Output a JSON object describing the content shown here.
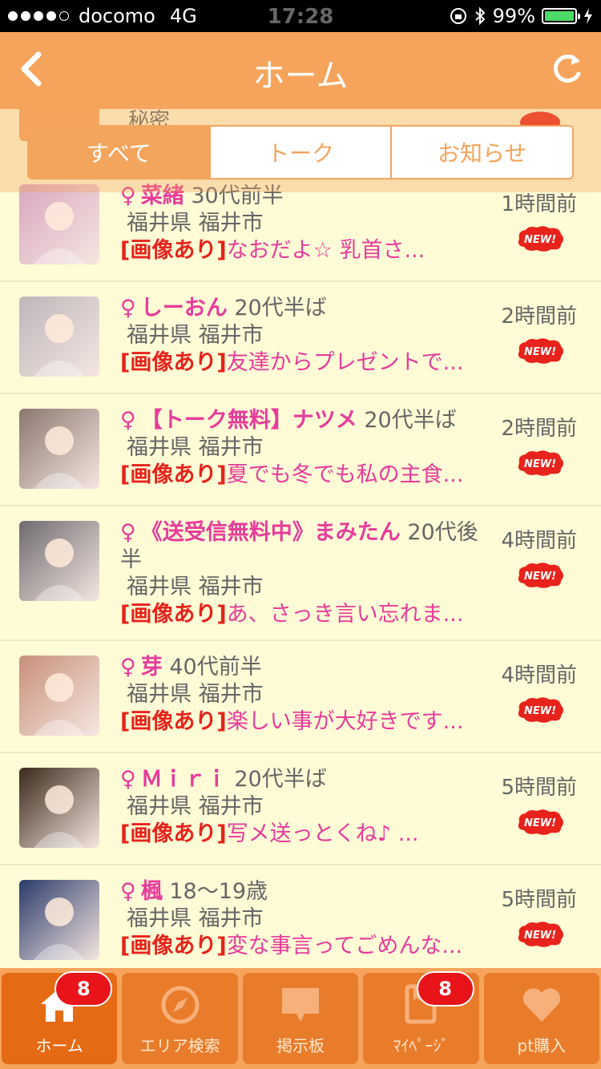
{
  "status": {
    "carrier": "docomo",
    "network": "4G",
    "time": "17:28",
    "battery": "99%"
  },
  "nav": {
    "title": "ホーム"
  },
  "segments": [
    "すべて",
    "トーク",
    "お知らせ"
  ],
  "partial_row": {
    "text": "秘密"
  },
  "rows": [
    {
      "symbol": "♀",
      "name": "菜緒",
      "age": "30代前半",
      "location": "福井県 福井市",
      "tag": "[画像あり]",
      "message": "なおだよ☆ 乳首さ...",
      "time": "1時間前",
      "avatar_color": "#d9a7c0"
    },
    {
      "symbol": "♀",
      "name": "しーおん",
      "age": "20代半ば",
      "location": "福井県 福井市",
      "tag": "[画像あり]",
      "message": "友達からプレゼントで...",
      "time": "2時間前",
      "avatar_color": "#bfb6bb"
    },
    {
      "symbol": "♀",
      "name": "【トーク無料】ナツメ",
      "age": "20代半ば",
      "location": "福井県 福井市",
      "tag": "[画像あり]",
      "message": "夏でも冬でも私の主食...",
      "time": "2時間前",
      "avatar_color": "#8a7870"
    },
    {
      "symbol": "♀",
      "name": "《送受信無料中》まみたん",
      "age": "20代後半",
      "location": "福井県 福井市",
      "tag": "[画像あり]",
      "message": "あ、さっき言い忘れま...",
      "time": "4時間前",
      "avatar_color": "#6e6a70"
    },
    {
      "symbol": "♀",
      "name": "芽",
      "age": "40代前半",
      "location": "福井県 福井市",
      "tag": "[画像あり]",
      "message": "楽しい事が大好きです...",
      "time": "4時間前",
      "avatar_color": "#c8907a"
    },
    {
      "symbol": "♀",
      "name": "Ｍｉｒｉ",
      "age": "20代半ば",
      "location": "福井県 福井市",
      "tag": "[画像あり]",
      "message": "写メ送っとくね♪ ...",
      "time": "5時間前",
      "avatar_color": "#3a2a1a"
    },
    {
      "symbol": "♀",
      "name": "楓",
      "age": "18～19歳",
      "location": "福井県 福井市",
      "tag": "[画像あり]",
      "message": "変な事言ってごめんな...",
      "time": "5時間前",
      "avatar_color": "#2a3a6a"
    }
  ],
  "tabs": [
    {
      "label": "ホーム",
      "icon": "home-icon",
      "badge": "8"
    },
    {
      "label": "エリア検索",
      "icon": "compass-icon",
      "badge": ""
    },
    {
      "label": "掲示板",
      "icon": "chat-bubble-icon",
      "badge": ""
    },
    {
      "label": "ﾏｲﾍﾟｰｼﾞ",
      "icon": "mypage-book-icon",
      "badge": "8"
    },
    {
      "label": "pt購入",
      "icon": "heart-icon",
      "badge": ""
    }
  ],
  "colors": {
    "accent": "#f6a45c",
    "list_bg": "#fefbd6",
    "pink": "#e63c9a",
    "red": "#e5231b"
  }
}
